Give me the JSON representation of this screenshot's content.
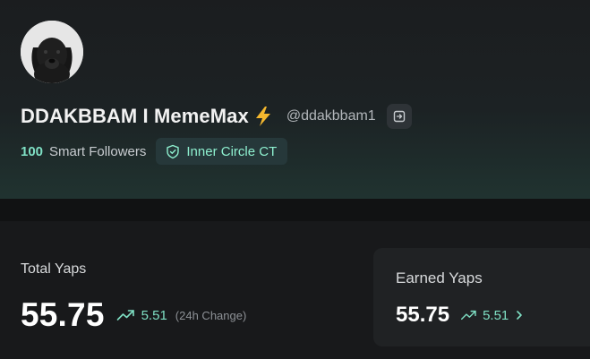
{
  "profile": {
    "display_name": "DDAKBBAM I MemeMax",
    "handle": "@ddakbbam1",
    "avatar_icon": "black-puppy-avatar",
    "name_emoji_icon": "lightning-bolt-icon",
    "copy_icon": "copy-link-icon",
    "smart_followers_count": "100",
    "smart_followers_label": "Smart Followers",
    "badge_icon": "shield-icon",
    "badge_label": "Inner Circle CT"
  },
  "total_yaps": {
    "label": "Total Yaps",
    "value": "55.75",
    "trend_icon": "trending-up-icon",
    "change": "5.51",
    "change_note": "(24h Change)"
  },
  "earned_yaps": {
    "label": "Earned Yaps",
    "value": "55.75",
    "trend_icon": "trending-up-icon",
    "change": "5.51",
    "chevron_icon": "chevron-right-icon"
  },
  "colors": {
    "accent": "#7fe0c4",
    "background": "#18191b",
    "card": "#202224",
    "bolt": "#f5b82e"
  }
}
